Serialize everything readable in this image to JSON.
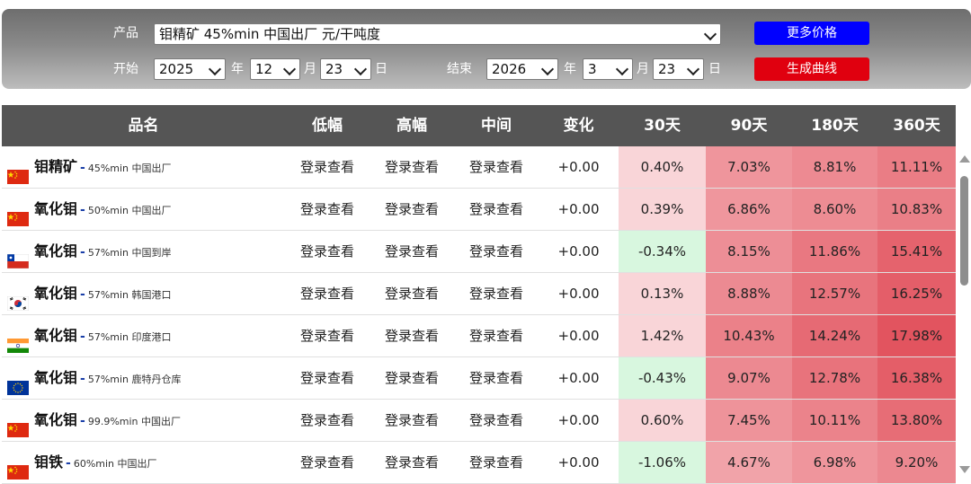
{
  "filters": {
    "product_label": "产品",
    "product_value": "钼精矿 45%min 中国出厂 元/干吨度",
    "more_prices_button": "更多价格",
    "start_label": "开始",
    "start_year": "2025",
    "start_month": "12",
    "start_day": "23",
    "end_label": "结束",
    "end_year": "2026",
    "end_month": "3",
    "end_day": "23",
    "year_unit": "年",
    "month_unit": "月",
    "day_unit": "日",
    "generate_button": "生成曲线"
  },
  "colors": {
    "more_prices_button": "#0000ff",
    "generate_button": "#e0000f",
    "header_bg": "#555555",
    "negative_cell": "#d8f7df",
    "low_positive_cell": "#f9d5d8"
  },
  "table": {
    "headers": [
      "品名",
      "低幅",
      "高幅",
      "中间",
      "变化",
      "30天",
      "90天",
      "180天",
      "360天"
    ],
    "rows": [
      {
        "flag": "china-flag",
        "name": "钼精矿",
        "spec": "45%min 中国出厂",
        "low": "登录查看",
        "high": "登录查看",
        "mid": "登录查看",
        "change": "+0.00",
        "d30": "0.40%",
        "d90": "7.03%",
        "d180": "8.81%",
        "d360": "11.11%"
      },
      {
        "flag": "china-flag",
        "name": "氧化钼",
        "spec": "50%min 中国出厂",
        "low": "登录查看",
        "high": "登录查看",
        "mid": "登录查看",
        "change": "+0.00",
        "d30": "0.39%",
        "d90": "6.86%",
        "d180": "8.60%",
        "d360": "10.83%"
      },
      {
        "flag": "chile-flag",
        "name": "氧化钼",
        "spec": "57%min 中国到岸",
        "low": "登录查看",
        "high": "登录查看",
        "mid": "登录查看",
        "change": "+0.00",
        "d30": "-0.34%",
        "d90": "8.15%",
        "d180": "11.86%",
        "d360": "15.41%"
      },
      {
        "flag": "korea-flag",
        "name": "氧化钼",
        "spec": "57%min 韩国港口",
        "low": "登录查看",
        "high": "登录查看",
        "mid": "登录查看",
        "change": "+0.00",
        "d30": "0.13%",
        "d90": "8.88%",
        "d180": "12.57%",
        "d360": "16.25%"
      },
      {
        "flag": "india-flag",
        "name": "氧化钼",
        "spec": "57%min 印度港口",
        "low": "登录查看",
        "high": "登录查看",
        "mid": "登录查看",
        "change": "+0.00",
        "d30": "1.42%",
        "d90": "10.43%",
        "d180": "14.24%",
        "d360": "17.98%"
      },
      {
        "flag": "eu-flag",
        "name": "氧化钼",
        "spec": "57%min 鹿特丹仓库",
        "low": "登录查看",
        "high": "登录查看",
        "mid": "登录查看",
        "change": "+0.00",
        "d30": "-0.43%",
        "d90": "9.07%",
        "d180": "12.78%",
        "d360": "16.38%"
      },
      {
        "flag": "china-flag",
        "name": "氧化钼",
        "spec": "99.9%min 中国出厂",
        "low": "登录查看",
        "high": "登录查看",
        "mid": "登录查看",
        "change": "+0.00",
        "d30": "0.60%",
        "d90": "7.45%",
        "d180": "10.11%",
        "d360": "13.80%"
      },
      {
        "flag": "china-flag",
        "name": "钼铁",
        "spec": "60%min 中国出厂",
        "low": "登录查看",
        "high": "登录查看",
        "mid": "登录查看",
        "change": "+0.00",
        "d30": "-1.06%",
        "d90": "4.67%",
        "d180": "6.98%",
        "d360": "9.20%"
      }
    ]
  }
}
